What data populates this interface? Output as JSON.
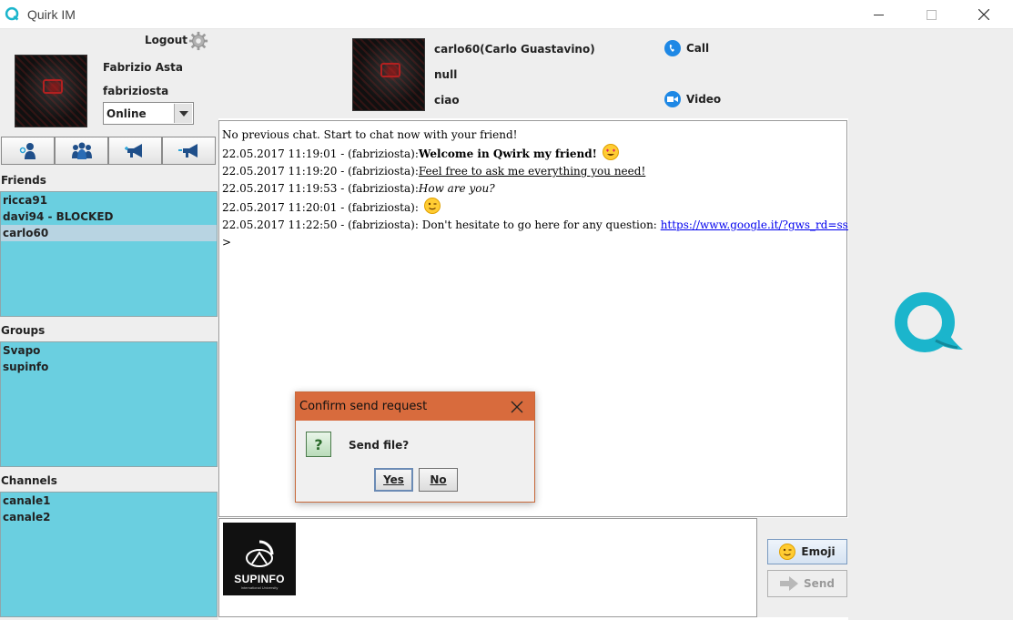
{
  "window": {
    "title": "Quirk IM"
  },
  "user": {
    "logout_label": "Logout",
    "full_name": "Fabrizio Asta",
    "username": "fabriziosta",
    "status": "Online"
  },
  "sections": {
    "friends_label": "Friends",
    "groups_label": "Groups",
    "channels_label": "Channels"
  },
  "friends": [
    "ricca91",
    "davi94 - BLOCKED",
    "carlo60"
  ],
  "groups": [
    "Svapo",
    "supinfo"
  ],
  "channels": [
    "canale1",
    "canale2"
  ],
  "contact": {
    "name": "carlo60(Carlo Guastavino)",
    "field2": "null",
    "mood": "ciao",
    "call_label": "Call",
    "video_label": "Video"
  },
  "chat": {
    "intro": "No previous chat. Start to chat now with your friend!",
    "messages": [
      {
        "meta": "22.05.2017 11:19:01 - (fabriziosta):",
        "text": "Welcome in Qwirk my friend!"
      },
      {
        "meta": "22.05.2017 11:19:20 - (fabriziosta):",
        "text": "Feel free to ask me everything you need!"
      },
      {
        "meta": "22.05.2017 11:19:53 - (fabriziosta):",
        "text": "How are you?"
      },
      {
        "meta": "22.05.2017 11:20:01 - (fabriziosta):",
        "text": ""
      },
      {
        "meta": "22.05.2017 11:22:50 - (fabriziosta):",
        "text": "Don't hesitate to go here for any question:",
        "link": "https://www.google.it/?gws_rd=ssl"
      }
    ],
    "prompt": ">"
  },
  "attachment": {
    "label": "SUPINFO",
    "sub": "International University"
  },
  "buttons": {
    "emoji_label": "Emoji",
    "send_label": "Send"
  },
  "dialog": {
    "title": "Confirm send request",
    "message": "Send file?",
    "yes_label": "Yes",
    "no_label": "No"
  },
  "colors": {
    "list_bg": "#6acfe0",
    "dialog_title": "#d86b3d",
    "logo": "#1bb5cc"
  }
}
